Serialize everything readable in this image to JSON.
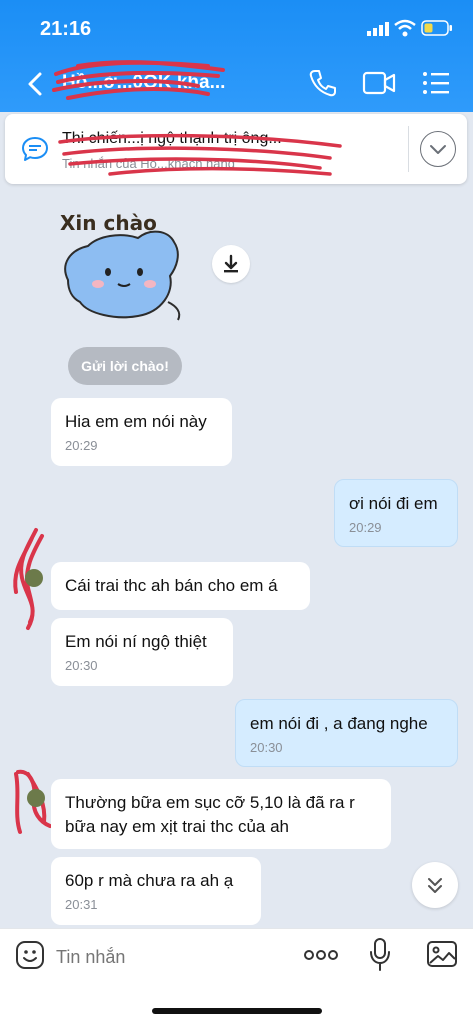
{
  "status_bar": {
    "time": "21:16"
  },
  "header": {
    "title": "Hồ...ờ...0OK kha...",
    "icons": [
      "back-arrow-icon",
      "phone-icon",
      "video-icon",
      "menu-icon"
    ]
  },
  "pinned": {
    "title": "Thi chiến...ị ngộ thạnh trị ông...",
    "subtitle": "Tin nhắn của Hồ...khách hàng"
  },
  "sticker": {
    "caption": "Xin chào"
  },
  "greet_button": "Gửi lời chào!",
  "messages": [
    {
      "dir": "in",
      "text": "Hia em em nói này",
      "time": "20:29"
    },
    {
      "dir": "out",
      "text": "ơi nói đi em",
      "time": "20:29"
    },
    {
      "dir": "in",
      "text": "Cái trai thc ah bán cho em á",
      "time": ""
    },
    {
      "dir": "in",
      "text": "Em nói ní ngộ thiệt",
      "time": "20:30"
    },
    {
      "dir": "out",
      "text": "em nói đi , a đang nghe",
      "time": "20:30"
    },
    {
      "dir": "in",
      "text": "Thường bữa em sục cỡ 5,10 là đã ra r",
      "text2": "bữa nay em xịt trai thc của ah",
      "time": ""
    },
    {
      "dir": "in",
      "text": "60p r mà chưa ra ah ạ",
      "time": "20:31"
    }
  ],
  "input": {
    "placeholder": "Tin nhắn"
  },
  "colors": {
    "header_blue": "#1b8ef5",
    "out_bubble": "#d5ecff",
    "background": "#e2e8f1"
  }
}
